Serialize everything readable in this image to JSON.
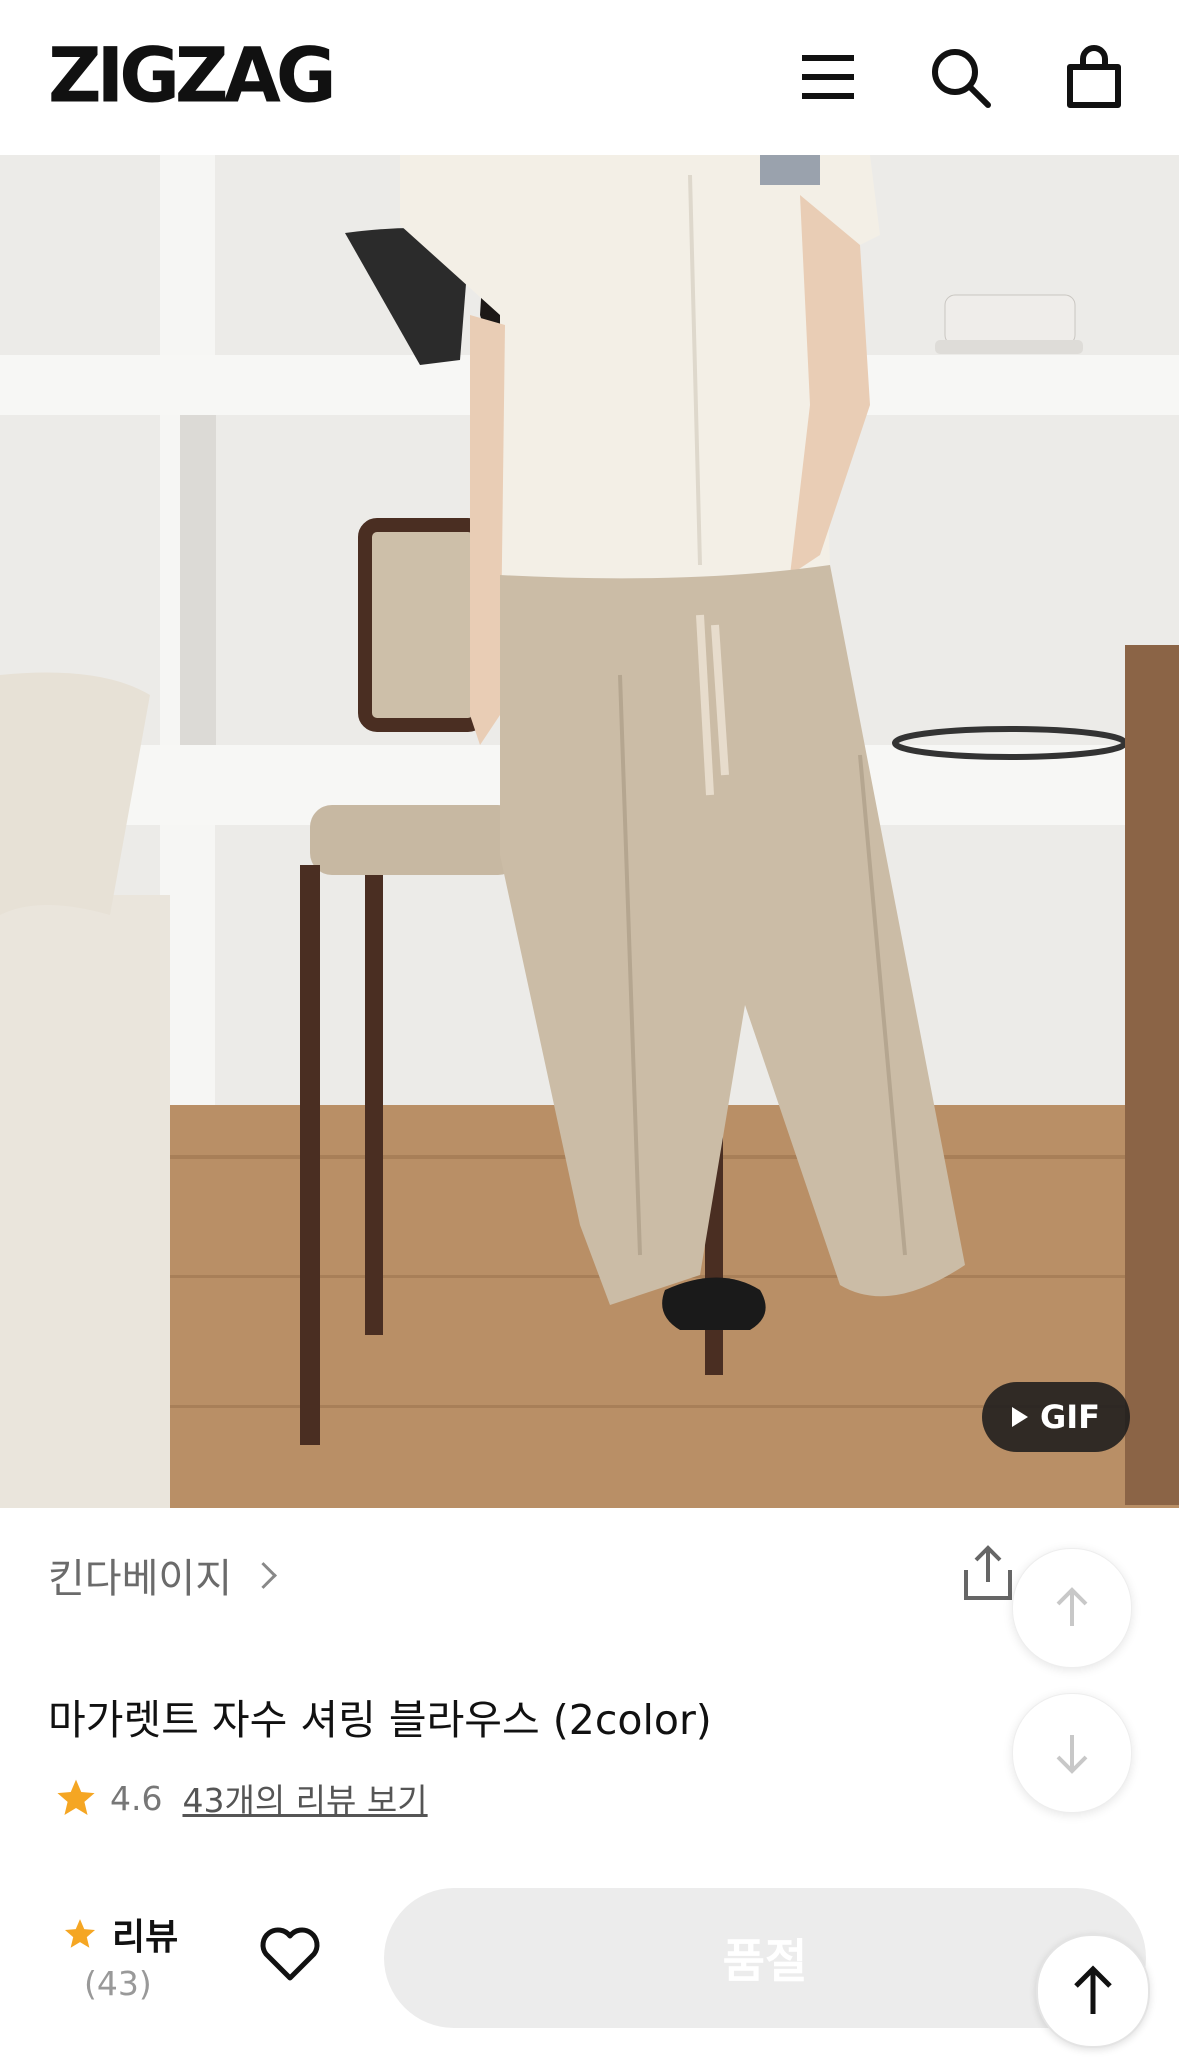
{
  "header": {
    "logo": "ZIGZAG",
    "icons": [
      "menu-icon",
      "search-icon",
      "shopping-bag-icon"
    ]
  },
  "hero": {
    "badge_label": "GIF",
    "badge_icon": "play-icon"
  },
  "store": {
    "name": "킨다베이지",
    "icons": [
      "chevron-right-icon",
      "share-icon"
    ]
  },
  "product": {
    "title": "마가렛트 자수 셔링 블라우스 (2color)",
    "rating": "4.6",
    "review_link": "43개의 리뷰 보기"
  },
  "scroll_buttons": [
    "arrow-up-icon",
    "arrow-down-icon"
  ],
  "bottom_bar": {
    "review_label": "리뷰",
    "review_count": "(43)",
    "cta_label": "품절",
    "icons": [
      "star-icon",
      "heart-icon",
      "scroll-to-top-icon"
    ]
  },
  "colors": {
    "star": "#F5A623",
    "cta_disabled_bg": "#ECECEC",
    "badge_bg": "#1C1C1C"
  }
}
